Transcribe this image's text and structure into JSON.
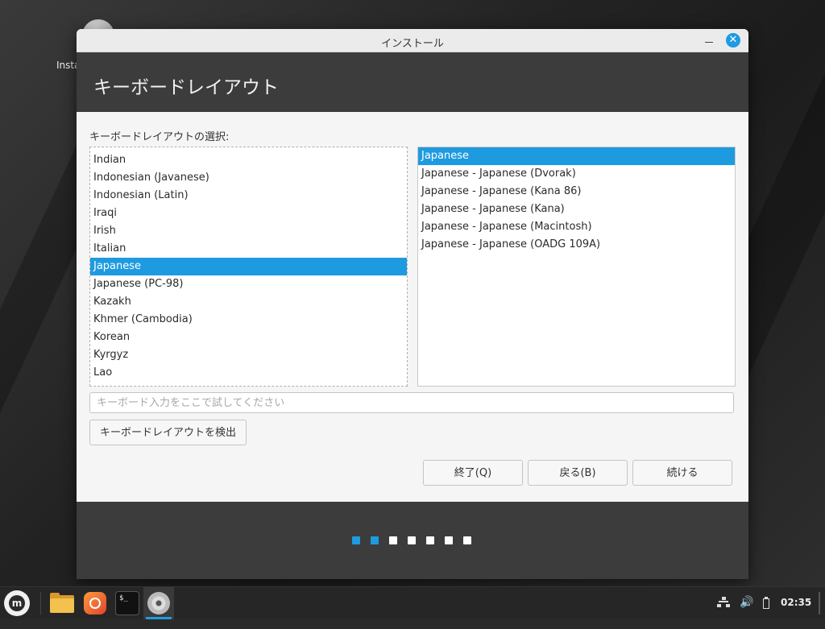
{
  "desktop": {
    "icon_label": "Insta"
  },
  "window": {
    "title": "インストール",
    "close_glyph": "✕",
    "header_title": "キーボードレイアウト",
    "selection_label": "キーボードレイアウトの選択:",
    "layouts": [
      "Indian",
      "Indonesian (Javanese)",
      "Indonesian (Latin)",
      "Iraqi",
      "Irish",
      "Italian",
      "Japanese",
      "Japanese (PC-98)",
      "Kazakh",
      "Khmer (Cambodia)",
      "Korean",
      "Kyrgyz",
      "Lao"
    ],
    "selected_layout": "Japanese",
    "variants": [
      "Japanese",
      "Japanese - Japanese (Dvorak)",
      "Japanese - Japanese (Kana 86)",
      "Japanese - Japanese (Kana)",
      "Japanese - Japanese (Macintosh)",
      "Japanese - Japanese (OADG 109A)"
    ],
    "selected_variant": "Japanese",
    "test_placeholder": "キーボード入力をここで試してください",
    "detect_button": "キーボードレイアウトを検出",
    "quit_button": "終了(Q)",
    "back_button": "戻る(B)",
    "next_button": "続ける",
    "progress": {
      "total_steps": 7,
      "completed_steps": 2
    }
  },
  "taskbar": {
    "menu_icon": "linux-mint-menu-icon",
    "terminal_prompt": "$_",
    "clock": "02:35",
    "volume_glyph": "🔊"
  },
  "colors": {
    "accent": "#1e9be0",
    "header_bg": "#3c3c3c",
    "taskbar_bg": "#262626"
  }
}
